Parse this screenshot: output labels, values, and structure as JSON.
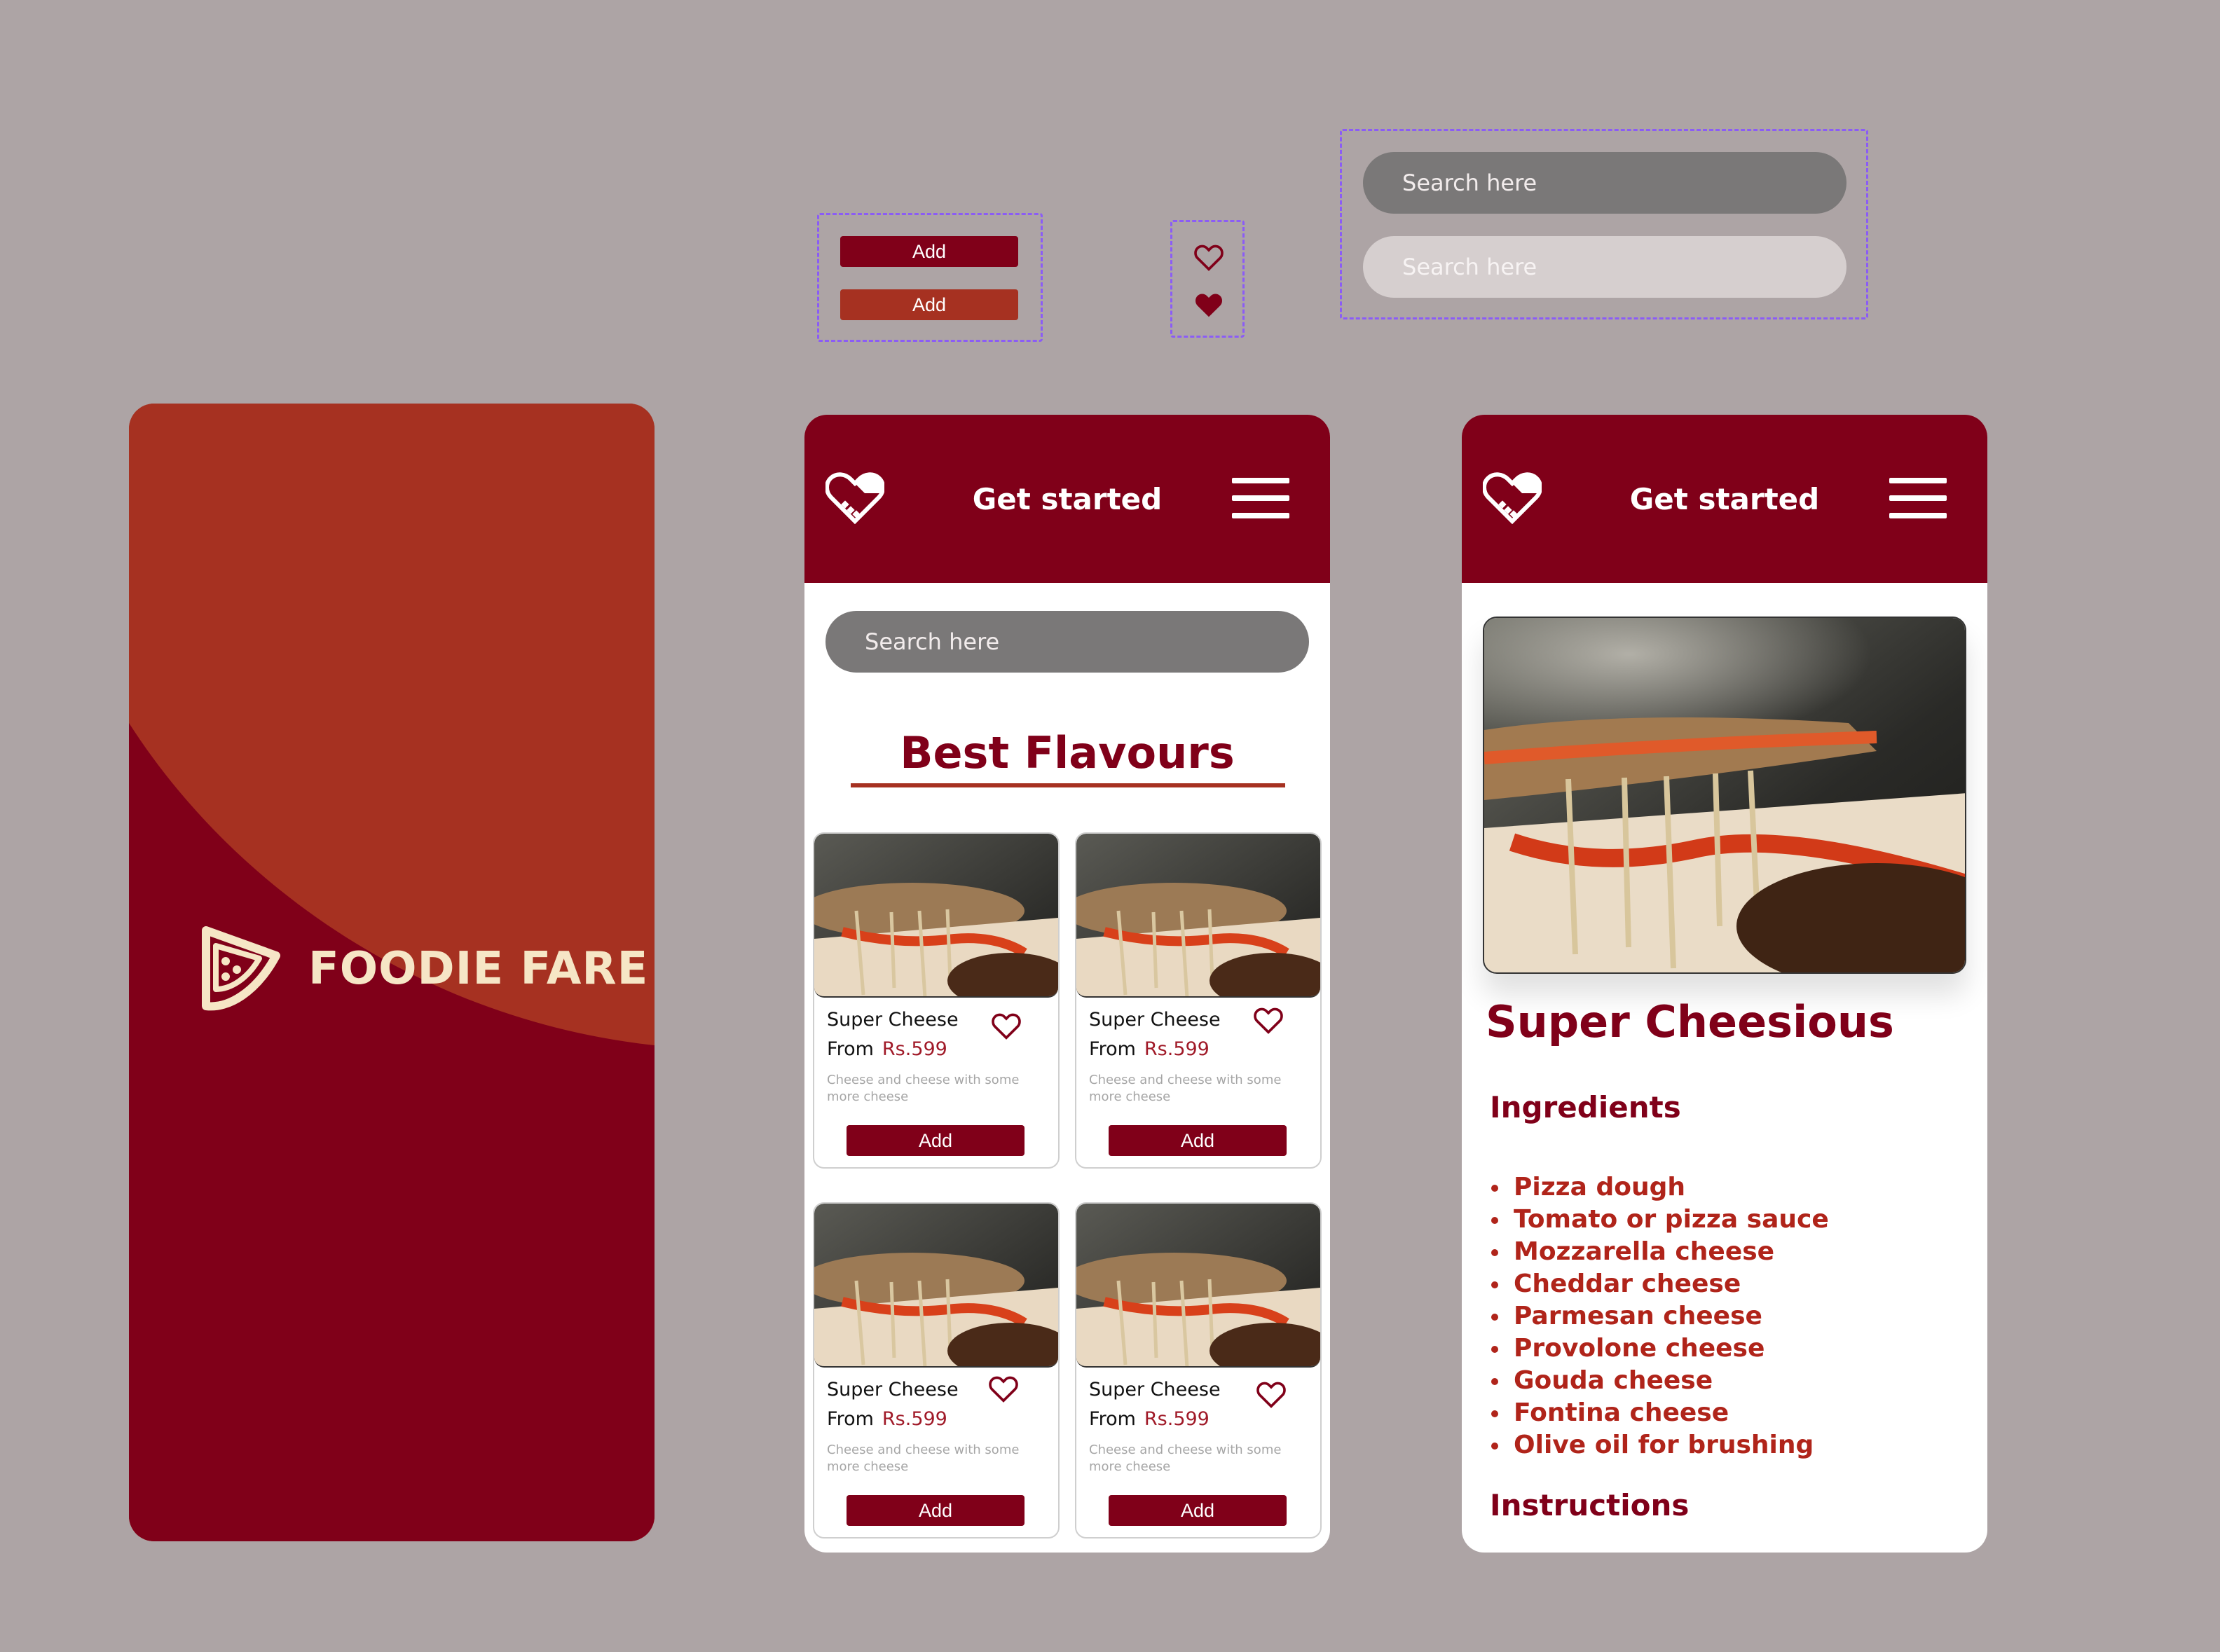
{
  "components": {
    "add_buttons": [
      {
        "label": "Add",
        "color": "#800019",
        "state": "default"
      },
      {
        "label": "Add",
        "color": "#a63121",
        "state": "hover"
      }
    ],
    "hearts": [
      {
        "icon": "heart-outline-icon",
        "state": "default"
      },
      {
        "icon": "heart-filled-icon",
        "state": "liked"
      }
    ],
    "search_fields": [
      {
        "placeholder": "Search here",
        "state": "default"
      },
      {
        "placeholder": "Search here",
        "state": "hover"
      }
    ]
  },
  "splash": {
    "brand": "FOODIE FARE",
    "colors": {
      "top": "#a63121",
      "bottom": "#800019",
      "logo": "#f6e6c6"
    }
  },
  "home": {
    "header": {
      "title": "Get started",
      "logo_icon": "heart-handshake-icon",
      "menu_icon": "hamburger-menu-icon"
    },
    "search": {
      "placeholder": "Search here"
    },
    "section_title": "Best Flavours",
    "products": [
      {
        "name": "Super Cheese",
        "from_label": "From",
        "price": "Rs.599",
        "description": "Cheese and cheese with some more cheese",
        "button": "Add"
      },
      {
        "name": "Super Cheese",
        "from_label": "From",
        "price": "Rs.599",
        "description": "Cheese and cheese with some more cheese",
        "button": "Add"
      },
      {
        "name": "Super Cheese",
        "from_label": "From",
        "price": "Rs.599",
        "description": "Cheese and cheese with some more cheese",
        "button": "Add"
      },
      {
        "name": "Super Cheese",
        "from_label": "From",
        "price": "Rs.599",
        "description": "Cheese and cheese with some more cheese",
        "button": "Add"
      }
    ]
  },
  "detail": {
    "header": {
      "title": "Get started",
      "logo_icon": "heart-handshake-icon",
      "menu_icon": "hamburger-menu-icon"
    },
    "title": "Super Cheesious",
    "ingredients_title": "Ingredients",
    "ingredients": [
      "Pizza dough",
      "Tomato or pizza sauce",
      "Mozzarella cheese",
      "Cheddar cheese",
      "Parmesan cheese",
      "Provolone cheese",
      "Gouda cheese",
      "Fontina cheese",
      "Olive oil for brushing"
    ],
    "instructions_title": "Instructions"
  },
  "theme": {
    "primary": "#800019",
    "accent": "#a63121",
    "background": "#ada4a5",
    "search_dark": "#7a7878",
    "search_light": "#d6cfcf"
  }
}
